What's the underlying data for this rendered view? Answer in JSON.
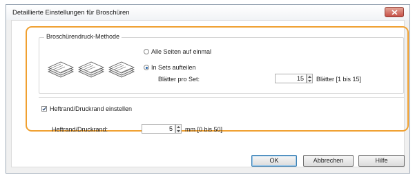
{
  "dialog": {
    "title": "Detaillierte Einstellungen für Broschüren"
  },
  "booklet_group": {
    "title": "Broschürendruck-Methode",
    "options": [
      {
        "label": "Alle Seiten auf einmal",
        "selected": false
      },
      {
        "label": "In Sets aufteilen",
        "selected": true
      }
    ],
    "sheets_per_set": {
      "label": "Blätter pro Set:",
      "value": "15",
      "unit": "Blätter [1 bis 15]"
    }
  },
  "gutter": {
    "checkbox_label": "Heftrand/Druckrand einstellen",
    "checked": true,
    "field_label": "Heftrand/Druckrand:",
    "value": "5",
    "unit": "mm [0 bis 50]"
  },
  "buttons": {
    "ok": "OK",
    "cancel": "Abbrechen",
    "help": "Hilfe"
  },
  "colors": {
    "highlight_frame": "#f0a030",
    "close_button": "#c75048"
  },
  "icons": [
    "close-icon",
    "booklet-icon",
    "spin-up-icon",
    "spin-down-icon",
    "checkmark-icon"
  ]
}
